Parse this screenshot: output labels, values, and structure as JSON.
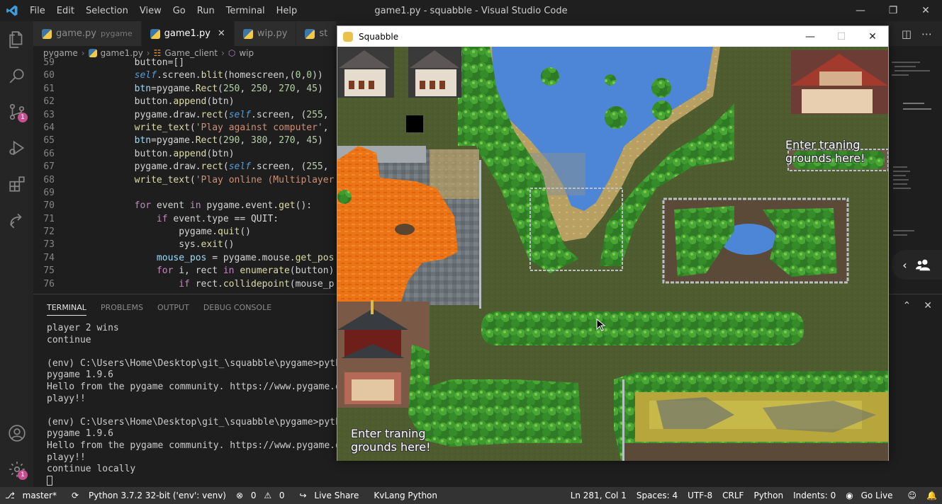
{
  "titlebar": {
    "menu": [
      "File",
      "Edit",
      "Selection",
      "View",
      "Go",
      "Run",
      "Terminal",
      "Help"
    ],
    "title": "game1.py - squabble - Visual Studio Code"
  },
  "activity": {
    "icons": [
      "files-icon",
      "search-icon",
      "source-control-icon",
      "run-debug-icon",
      "extensions-icon",
      "live-share-icon"
    ],
    "source_control_badge": "1",
    "settings_badge": "1"
  },
  "tabs": [
    {
      "label": "game.py",
      "sub": "pygame"
    },
    {
      "label": "game1.py",
      "sub": ""
    },
    {
      "label": "wip.py",
      "sub": ""
    },
    {
      "label": "st",
      "sub": ""
    }
  ],
  "breadcrumb": [
    "pygame",
    "game1.py",
    "Game_client",
    "wip"
  ],
  "code": {
    "line_numbers": [
      "59",
      "60",
      "61",
      "62",
      "63",
      "64",
      "65",
      "66",
      "67",
      "68",
      "69",
      "70",
      "71",
      "72",
      "73",
      "74",
      "75",
      "76"
    ]
  },
  "panel": {
    "tabs": [
      "TERMINAL",
      "PROBLEMS",
      "OUTPUT",
      "DEBUG CONSOLE"
    ],
    "terminal_lines": [
      "player 2 wins",
      "continue",
      "",
      "(env) C:\\Users\\Home\\Desktop\\git_\\squabble\\pygame>pytho",
      "pygame 1.9.6",
      "Hello from the pygame community. https://www.pygame.or",
      "playy!!",
      "",
      "(env) C:\\Users\\Home\\Desktop\\git_\\squabble\\pygame>pytho",
      "pygame 1.9.6",
      "Hello from the pygame community. https://www.pygame.or",
      "playy!!",
      "continue locally"
    ]
  },
  "pygame_window": {
    "title": "Squabble",
    "sign_top_right_line1": "Enter traning",
    "sign_top_right_line2": "grounds here!",
    "sign_bottom_left_line1": "Enter traning",
    "sign_bottom_left_line2": "grounds here!"
  },
  "status": {
    "branch": "master*",
    "python": "Python 3.7.2 32-bit ('env': venv)",
    "errors": "0",
    "warnings": "0",
    "live_share": "Live Share",
    "kvlang": "KvLang Python",
    "position": "Ln 281, Col 1",
    "spaces": "Spaces: 4",
    "encoding": "UTF-8",
    "eol": "CRLF",
    "language": "Python",
    "indents": "Indents: 0",
    "go_live": "Go Live"
  },
  "colors": {
    "accent": "#007acc",
    "statusbar": "#333333",
    "badge": "#c74e91",
    "orange_roof": "#f07a1a",
    "water": "#4d86d6"
  }
}
